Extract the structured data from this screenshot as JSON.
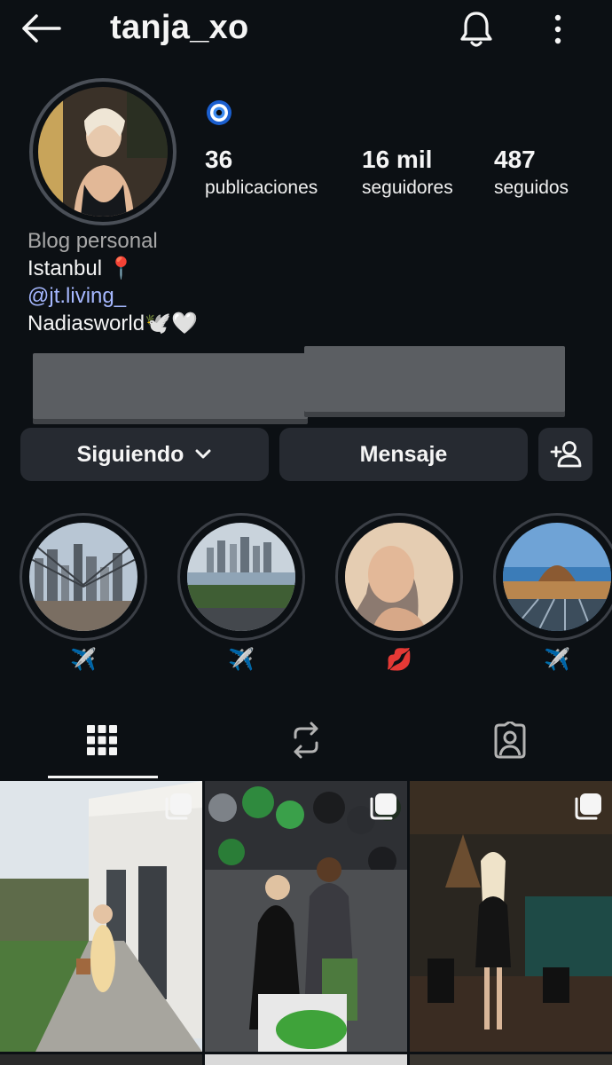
{
  "header": {
    "username": "tanja_xo",
    "back_icon": "arrow-left-icon",
    "notifications_icon": "bell-icon",
    "more_icon": "more-vertical-icon"
  },
  "profile": {
    "badge_icon": "evil-eye-icon",
    "stats": [
      {
        "count": "36",
        "label": "publicaciones"
      },
      {
        "count": "16 mil",
        "label": "seguidores"
      },
      {
        "count": "487",
        "label": "seguidos"
      }
    ],
    "bio": {
      "category": "Blog personal",
      "line1": "Istanbul 📍",
      "mention": "@jt.living_",
      "line3": "Nadiasworld🕊️🤍"
    }
  },
  "actions": {
    "following_label": "Siguiendo",
    "message_label": "Mensaje",
    "add_person_icon": "person-add-icon"
  },
  "highlights": [
    {
      "label": "✈️",
      "image": "city-bridge"
    },
    {
      "label": "✈️",
      "image": "city-skyline"
    },
    {
      "label": "💋",
      "image": "selfie"
    },
    {
      "label": "✈️",
      "image": "sea-view"
    }
  ],
  "tabs": [
    {
      "name": "grid",
      "icon": "grid-icon",
      "active": true
    },
    {
      "name": "reposts",
      "icon": "repost-icon",
      "active": false
    },
    {
      "name": "tagged",
      "icon": "tagged-person-icon",
      "active": false
    }
  ],
  "colors": {
    "background": "#0c1014",
    "button": "#262a31",
    "link": "#a6b8ff",
    "muted": "#a8a8a8"
  }
}
